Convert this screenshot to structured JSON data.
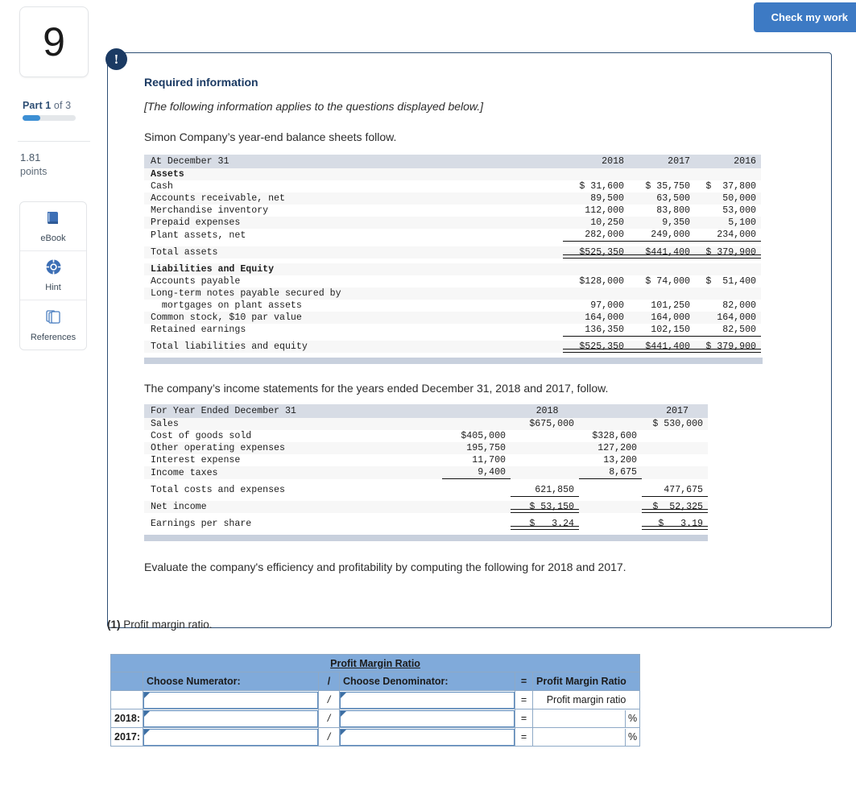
{
  "sidebar": {
    "question_number": "9",
    "part_prefix": "Part 1",
    "part_suffix": " of 3",
    "points_value": "1.81",
    "points_label": "points",
    "tools": [
      {
        "icon": "book-icon",
        "label": "eBook"
      },
      {
        "icon": "lifebuoy-icon",
        "label": "Hint"
      },
      {
        "icon": "copy-pages-icon",
        "label": "References"
      }
    ]
  },
  "toolbar": {
    "check_my_work_label": "Check my work"
  },
  "card": {
    "alert_glyph": "!",
    "required_title": "Required information",
    "required_italic": "[The following information applies to the questions displayed below.]",
    "intro_balance": "Simon Company’s year-end balance sheets follow.",
    "intro_income": "The company’s income statements for the years ended December 31, 2018 and 2017, follow.",
    "closing": "Evaluate the company's efficiency and profitability by computing the following for 2018 and 2017."
  },
  "balance_sheet": {
    "header_label": "At December 31",
    "columns": [
      "2018",
      "2017",
      "2016"
    ],
    "rows": [
      {
        "label": "Assets",
        "kind": "section",
        "values": [
          "",
          "",
          ""
        ]
      },
      {
        "label": "Cash",
        "kind": "item",
        "values": [
          "$ 31,600",
          "$ 35,750",
          "$  37,800"
        ]
      },
      {
        "label": "Accounts receivable, net",
        "kind": "item",
        "values": [
          "89,500",
          "63,500",
          "50,000"
        ]
      },
      {
        "label": "Merchandise inventory",
        "kind": "item",
        "values": [
          "112,000",
          "83,800",
          "53,000"
        ]
      },
      {
        "label": "Prepaid expenses",
        "kind": "item",
        "values": [
          "10,250",
          "9,350",
          "5,100"
        ]
      },
      {
        "label": "Plant assets, net",
        "kind": "item-u1",
        "values": [
          "282,000",
          "249,000",
          "234,000"
        ]
      },
      {
        "label": "Total assets",
        "kind": "total",
        "values": [
          "$525,350",
          "$441,400",
          "$ 379,900"
        ]
      },
      {
        "label": "Liabilities and Equity",
        "kind": "section",
        "values": [
          "",
          "",
          ""
        ]
      },
      {
        "label": "Accounts payable",
        "kind": "item",
        "values": [
          "$128,000",
          "$ 74,000",
          "$  51,400"
        ]
      },
      {
        "label": "Long-term notes payable secured by",
        "kind": "item",
        "values": [
          "",
          "",
          ""
        ]
      },
      {
        "label": "  mortgages on plant assets",
        "kind": "item",
        "values": [
          "97,000",
          "101,250",
          "82,000"
        ]
      },
      {
        "label": "Common stock, $10 par value",
        "kind": "item",
        "values": [
          "164,000",
          "164,000",
          "164,000"
        ]
      },
      {
        "label": "Retained earnings",
        "kind": "item-u1",
        "values": [
          "136,350",
          "102,150",
          "82,500"
        ]
      },
      {
        "label": "Total liabilities and equity",
        "kind": "total",
        "values": [
          "$525,350",
          "$441,400",
          "$ 379,900"
        ]
      }
    ]
  },
  "income_statement": {
    "header_label": "For Year Ended December 31",
    "columns": [
      "2018",
      "2017"
    ],
    "rows": [
      {
        "label": "Sales",
        "c2018a": "",
        "c2018b": "$675,000",
        "c2017a": "",
        "c2017b": "$ 530,000"
      },
      {
        "label": "Cost of goods sold",
        "c2018a": "$405,000",
        "c2018b": "",
        "c2017a": "$328,600",
        "c2017b": ""
      },
      {
        "label": "Other operating expenses",
        "c2018a": "195,750",
        "c2018b": "",
        "c2017a": "127,200",
        "c2017b": ""
      },
      {
        "label": "Interest expense",
        "c2018a": "11,700",
        "c2018b": "",
        "c2017a": "13,200",
        "c2017b": ""
      },
      {
        "label": "Income taxes",
        "c2018a": "9,400",
        "c2018b": "",
        "c2017a": "8,675",
        "c2017b": ""
      },
      {
        "label": "Total costs and expenses",
        "c2018a": "",
        "c2018b": "621,850",
        "c2017a": "",
        "c2017b": "477,675"
      },
      {
        "label": "Net income",
        "c2018a": "",
        "c2018b": "$ 53,150",
        "c2017a": "",
        "c2017b": "$  52,325"
      },
      {
        "label": "Earnings per share",
        "c2018a": "",
        "c2018b": "$   3.24",
        "c2017a": "",
        "c2017b": "$   3.19"
      }
    ]
  },
  "question": {
    "number": "(1)",
    "text": " Profit margin ratio.",
    "table": {
      "title": "Profit Margin Ratio",
      "col_numerator": "Choose Numerator:",
      "col_slash": "/",
      "col_denominator": "Choose Denominator:",
      "col_equals": "=",
      "col_result": "Profit Margin Ratio",
      "result_row_label": "Profit margin ratio",
      "slash_symbol": "/",
      "equals_symbol": "=",
      "percent_symbol": "%",
      "rows": [
        {
          "year": "",
          "numerator": "",
          "denominator": "",
          "result": "Profit margin ratio",
          "has_percent": false
        },
        {
          "year": "2018:",
          "numerator": "",
          "denominator": "",
          "result": "",
          "has_percent": true
        },
        {
          "year": "2017:",
          "numerator": "",
          "denominator": "",
          "result": "",
          "has_percent": true
        }
      ]
    }
  },
  "colors": {
    "accent_blue": "#3d7ac4",
    "navy": "#1b3a63",
    "table_header": "#d7dce5",
    "form_blue": "#80aada",
    "footer_bar": "#c8d0dd"
  }
}
